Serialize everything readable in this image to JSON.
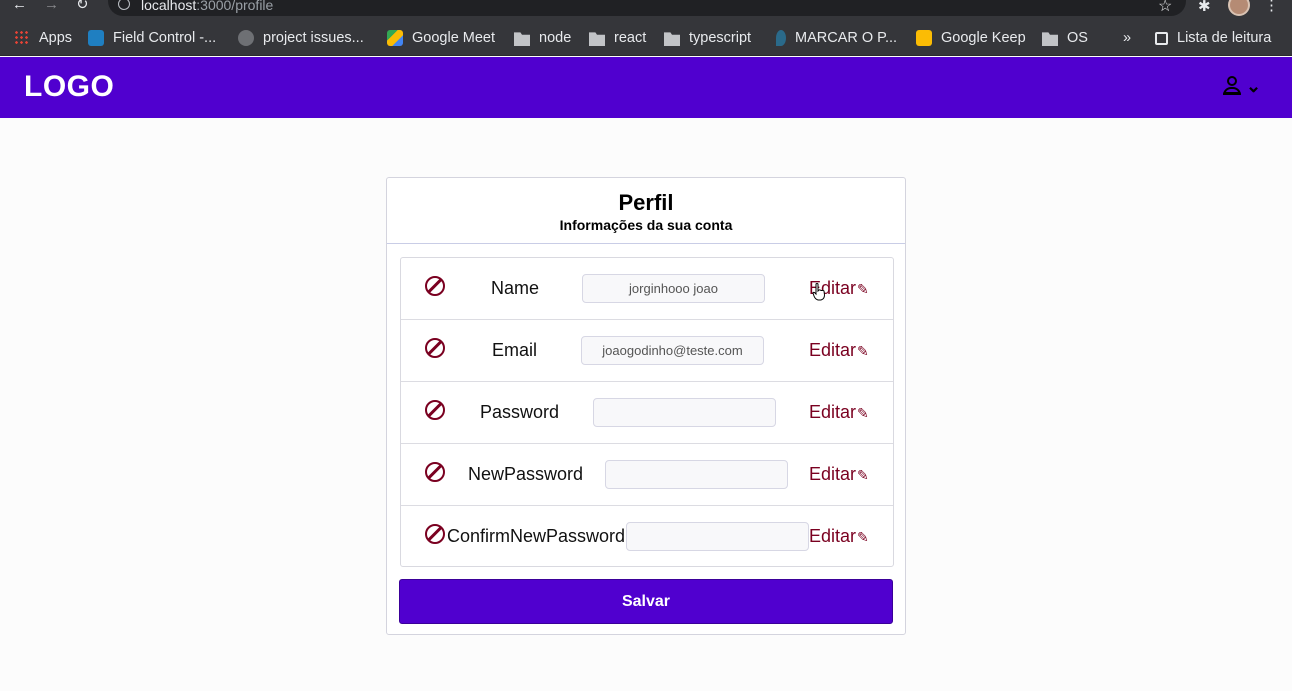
{
  "browser": {
    "url_host": "localhost",
    "url_path": ":3000/profile",
    "bookmarks": [
      {
        "label": "Apps",
        "icon": "apps-grid-icon"
      },
      {
        "label": "Field Control -...",
        "icon": "trello-icon"
      },
      {
        "label": "project issues...",
        "icon": "github-icon"
      },
      {
        "label": "Google Meet",
        "icon": "google-meet-icon"
      },
      {
        "label": "node",
        "icon": "folder-icon"
      },
      {
        "label": "react",
        "icon": "folder-icon"
      },
      {
        "label": "typescript",
        "icon": "folder-icon"
      },
      {
        "label": "MARCAR O P...",
        "icon": "map-pin-icon"
      },
      {
        "label": "Google Keep",
        "icon": "google-keep-icon"
      },
      {
        "label": "OS",
        "icon": "folder-icon"
      }
    ],
    "overflow": "»",
    "reading_list": "Lista de leitura"
  },
  "header": {
    "logo": "LOGO"
  },
  "profile": {
    "title": "Perfil",
    "subtitle": "Informações da sua conta",
    "edit_label": "Editar",
    "save_label": "Salvar",
    "fields": [
      {
        "label": "Name",
        "value": "jorginhooo joao"
      },
      {
        "label": "Email",
        "value": "joaogodinho@teste.com"
      },
      {
        "label": "Password",
        "value": ""
      },
      {
        "label": "NewPassword",
        "value": ""
      },
      {
        "label": "ConfirmNewPassword",
        "value": ""
      }
    ]
  },
  "colors": {
    "brand": "#5000cf",
    "accent": "#7a0020"
  }
}
